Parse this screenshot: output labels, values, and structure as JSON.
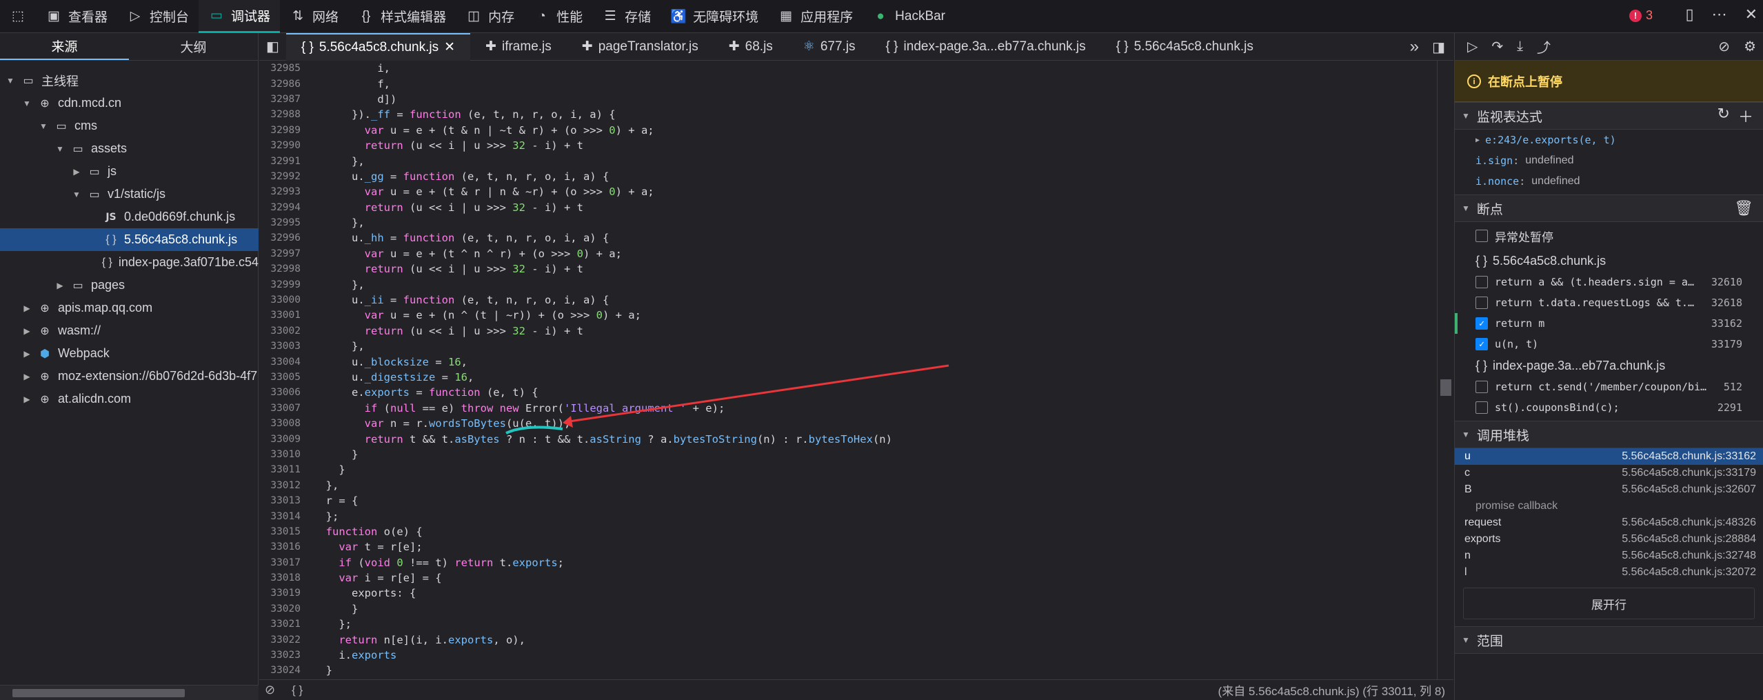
{
  "toolbar": {
    "items": [
      {
        "label": "查看器"
      },
      {
        "label": "控制台"
      },
      {
        "label": "调试器"
      },
      {
        "label": "网络"
      },
      {
        "label": "样式编辑器"
      },
      {
        "label": "内存"
      },
      {
        "label": "性能"
      },
      {
        "label": "存储"
      },
      {
        "label": "无障碍环境"
      },
      {
        "label": "应用程序"
      },
      {
        "label": "HackBar"
      }
    ],
    "error_count": "3",
    "accent": "#00b0a8"
  },
  "sources": {
    "tabs": [
      {
        "label": "来源"
      },
      {
        "label": "大纲"
      }
    ],
    "tree": [
      {
        "label": "主线程",
        "icon": "window-icon"
      },
      {
        "label": "cdn.mcd.cn",
        "icon": "globe-icon"
      },
      {
        "label": "cms",
        "icon": "folder-icon"
      },
      {
        "label": "assets",
        "icon": "folder-icon"
      },
      {
        "label": "js",
        "icon": "folder-icon"
      },
      {
        "label": "v1/static/js",
        "icon": "folder-icon"
      },
      {
        "label": "0.de0d669f.chunk.js",
        "icon": "js-file-icon"
      },
      {
        "label": "5.56c4a5c8.chunk.js",
        "icon": "brace-file-icon"
      },
      {
        "label": "index-page.3af071be.c54",
        "icon": "brace-file-icon"
      },
      {
        "label": "pages",
        "icon": "folder-icon"
      },
      {
        "label": "apis.map.qq.com",
        "icon": "globe-icon"
      },
      {
        "label": "wasm://",
        "icon": "globe-icon"
      },
      {
        "label": "Webpack",
        "icon": "webpack-icon"
      },
      {
        "label": "moz-extension://6b076d2d-6d3b-4f7",
        "icon": "globe-icon"
      },
      {
        "label": "at.alicdn.com",
        "icon": "globe-icon"
      }
    ]
  },
  "editor": {
    "tabs": [
      {
        "label": "5.56c4a5c8.chunk.js",
        "icon": "brace-file-icon"
      },
      {
        "label": "iframe.js",
        "icon": "puzzle-icon"
      },
      {
        "label": "pageTranslator.js",
        "icon": "puzzle-icon"
      },
      {
        "label": "68.js",
        "icon": "puzzle-icon"
      },
      {
        "label": "677.js",
        "icon": "react-icon"
      },
      {
        "label": "index-page.3a...eb77a.chunk.js",
        "icon": "brace-file-icon"
      },
      {
        "label": "5.56c4a5c8.chunk.js",
        "icon": "brace-file-icon"
      }
    ],
    "lines": [
      {
        "n": "32985",
        "code": "          i,"
      },
      {
        "n": "32986",
        "code": "          f,"
      },
      {
        "n": "32987",
        "code": "          d])"
      },
      {
        "n": "32988",
        "code": "      })._ff = function (e, t, n, r, o, i, a) {"
      },
      {
        "n": "32989",
        "code": "        var u = e + (t & n | ~t & r) + (o >>> 0) + a;"
      },
      {
        "n": "32990",
        "code": "        return (u << i | u >>> 32 - i) + t"
      },
      {
        "n": "32991",
        "code": "      },"
      },
      {
        "n": "32992",
        "code": "      u._gg = function (e, t, n, r, o, i, a) {"
      },
      {
        "n": "32993",
        "code": "        var u = e + (t & r | n & ~r) + (o >>> 0) + a;"
      },
      {
        "n": "32994",
        "code": "        return (u << i | u >>> 32 - i) + t"
      },
      {
        "n": "32995",
        "code": "      },"
      },
      {
        "n": "32996",
        "code": "      u._hh = function (e, t, n, r, o, i, a) {"
      },
      {
        "n": "32997",
        "code": "        var u = e + (t ^ n ^ r) + (o >>> 0) + a;"
      },
      {
        "n": "32998",
        "code": "        return (u << i | u >>> 32 - i) + t"
      },
      {
        "n": "32999",
        "code": "      },"
      },
      {
        "n": "33000",
        "code": "      u._ii = function (e, t, n, r, o, i, a) {"
      },
      {
        "n": "33001",
        "code": "        var u = e + (n ^ (t | ~r)) + (o >>> 0) + a;"
      },
      {
        "n": "33002",
        "code": "        return (u << i | u >>> 32 - i) + t"
      },
      {
        "n": "33003",
        "code": "      },"
      },
      {
        "n": "33004",
        "code": "      u._blocksize = 16,"
      },
      {
        "n": "33005",
        "code": "      u._digestsize = 16,"
      },
      {
        "n": "33006",
        "code": "      e.exports = function (e, t) {"
      },
      {
        "n": "33007",
        "code": "        if (null == e) throw new Error('Illegal argument ' + e);"
      },
      {
        "n": "33008",
        "code": "        var n = r.wordsToBytes(u(e, t));"
      },
      {
        "n": "33009",
        "code": "        return t && t.asBytes ? n : t && t.asString ? a.bytesToString(n) : r.bytesToHex(n)"
      },
      {
        "n": "33010",
        "code": "      }"
      },
      {
        "n": "33011",
        "code": "    }"
      },
      {
        "n": "33012",
        "code": "  },"
      },
      {
        "n": "33013",
        "code": "  r = {"
      },
      {
        "n": "33014",
        "code": "  };"
      },
      {
        "n": "33015",
        "code": "  function o(e) {"
      },
      {
        "n": "33016",
        "code": "    var t = r[e];"
      },
      {
        "n": "33017",
        "code": "    if (void 0 !== t) return t.exports;"
      },
      {
        "n": "33018",
        "code": "    var i = r[e] = {"
      },
      {
        "n": "33019",
        "code": "      exports: {"
      },
      {
        "n": "33020",
        "code": "      }"
      },
      {
        "n": "33021",
        "code": "    };"
      },
      {
        "n": "33022",
        "code": "    return n[e](i, i.exports, o),"
      },
      {
        "n": "33023",
        "code": "    i.exports"
      },
      {
        "n": "33024",
        "code": "  }"
      }
    ],
    "status": "(来自 5.56c4a5c8.chunk.js)  (行 33011, 列 8)",
    "status_left": "{ }"
  },
  "debugger": {
    "paused_label": "在断点上暂停",
    "watch": {
      "title": "监视表达式",
      "items": [
        {
          "expr": "e:243/e.exports(e, t)",
          "value": ""
        },
        {
          "expr": "i.sign",
          "value": "undefined"
        },
        {
          "expr": "i.nonce",
          "value": "undefined"
        }
      ]
    },
    "breakpoints": {
      "title": "断点",
      "pause_on_exceptions": "异常处暂停",
      "groups": [
        {
          "file": "5.56c4a5c8.chunk.js",
          "items": [
            {
              "text": "return a && (t.headers.sign = a…",
              "line": "32610",
              "checked": false
            },
            {
              "text": "return t.data.requestLogs && t.…",
              "line": "32618",
              "checked": false
            },
            {
              "text": "return m",
              "line": "33162",
              "checked": true
            },
            {
              "text": "u(n, t)",
              "line": "33179",
              "checked": true
            }
          ]
        },
        {
          "file": "index-page.3a...eb77a.chunk.js",
          "items": [
            {
              "text": "return ct.send('/member/coupon/bi…",
              "line": "512",
              "checked": false
            },
            {
              "text": "st().couponsBind(c);",
              "line": "2291",
              "checked": false
            }
          ]
        }
      ]
    },
    "callstack": {
      "title": "调用堆栈",
      "frames": [
        {
          "fn": "u",
          "loc": "5.56c4a5c8.chunk.js:33162"
        },
        {
          "fn": "c",
          "loc": "5.56c4a5c8.chunk.js:33179"
        },
        {
          "fn": "B",
          "loc": "5.56c4a5c8.chunk.js:32607"
        }
      ],
      "promise_label": "promise callback",
      "frames2": [
        {
          "fn": "request",
          "loc": "5.56c4a5c8.chunk.js:48326"
        },
        {
          "fn": "exports",
          "loc": "5.56c4a5c8.chunk.js:28884"
        },
        {
          "fn": "n",
          "loc": "5.56c4a5c8.chunk.js:32748"
        },
        {
          "fn": "l",
          "loc": "5.56c4a5c8.chunk.js:32072"
        }
      ],
      "expand_label": "展开行"
    },
    "scope_title": "范围"
  }
}
